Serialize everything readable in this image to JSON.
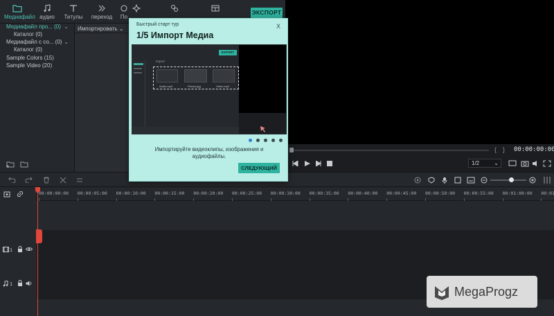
{
  "toolbar": {
    "tabs": [
      {
        "label": "Медиафайл",
        "icon": "folder-icon",
        "active": true
      },
      {
        "label": "аудио",
        "icon": "music-note-icon"
      },
      {
        "label": "Титулы",
        "icon": "text-icon"
      },
      {
        "label": "переход",
        "icon": "transition-icon"
      },
      {
        "label": "По",
        "icon": "effects-icon"
      },
      {
        "label": "",
        "icon": "sparkle-icon"
      },
      {
        "label": "",
        "icon": "elements-icon"
      },
      {
        "label": "",
        "icon": "split-screen-icon"
      }
    ],
    "export_label": "ЭКСПОРТ"
  },
  "library": {
    "items": [
      {
        "label": "Медиафайл про... (0)",
        "selected": true,
        "expanded": true
      },
      {
        "label": "Каталог (0)",
        "sub": true
      },
      {
        "label": "Медиафайл с со... (0)",
        "expanded": true
      },
      {
        "label": "Каталог (0)",
        "sub": true
      },
      {
        "label": "Sample Colors (15)"
      },
      {
        "label": "Sample Video (20)"
      }
    ],
    "import_label": "Импортировать"
  },
  "preview": {
    "timecode": "00:00:00:00",
    "ratio": "1/2"
  },
  "timeline": {
    "ticks": [
      "00:00:00:00",
      "00:00:05:00",
      "00:00:10:00",
      "00:00:15:00",
      "00:00:20:00",
      "00:00:25:00",
      "00:00:30:00",
      "00:00:35:00",
      "00:00:40:00",
      "00:00:45:00",
      "00:00:50:00",
      "00:00:55:00",
      "00:01:00:00",
      "00:01:05:00"
    ],
    "video_track": "1",
    "audio_track": "1"
  },
  "tour": {
    "header": "Быстрый старт тур",
    "title": "1/5 Импорт Медиа",
    "close": "X",
    "description": "Импортируйте видеоклипы, изображения и аудиофайлы.",
    "next_label": "СЛЕДУЮЩИЙ",
    "step_index": 0,
    "step_count": 5,
    "shot": {
      "export_label": "EXPORT",
      "import_label": "Import",
      "files": [
        "Audio.mp3",
        "Picture.jpg",
        "Video.mp4"
      ]
    }
  },
  "watermark": {
    "text": "MegaProgz"
  },
  "colors": {
    "accent": "#2fb3a0",
    "playhead": "#e0463a",
    "dialog": "#b9eee6"
  }
}
